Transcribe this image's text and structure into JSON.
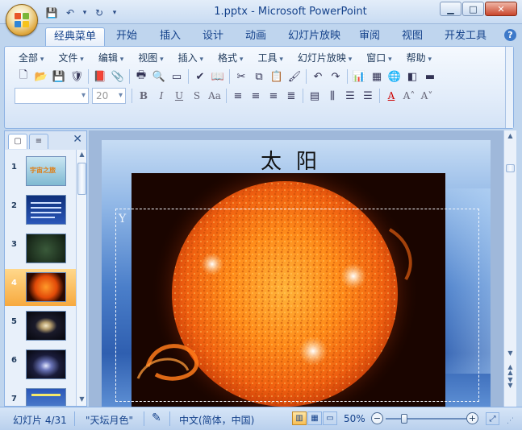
{
  "window": {
    "title": "1.pptx - Microsoft PowerPoint",
    "minimize": "▁",
    "maximize": "□",
    "close": "✕"
  },
  "quick_access": {
    "save": "💾",
    "undo": "↶",
    "redo": "↻",
    "customize": "▾"
  },
  "tabs": [
    "经典菜单",
    "开始",
    "插入",
    "设计",
    "动画",
    "幻灯片放映",
    "审阅",
    "视图",
    "开发工具"
  ],
  "active_tab": "经典菜单",
  "help_label": "?",
  "menu": [
    "全部",
    "文件",
    "编辑",
    "视图",
    "插入",
    "格式",
    "工具",
    "幻灯片放映",
    "窗口",
    "帮助"
  ],
  "toolbar1": [
    {
      "name": "new-document-icon",
      "glyph": "🗋"
    },
    {
      "name": "open-folder-icon",
      "glyph": "📂"
    },
    {
      "name": "save-icon",
      "glyph": "💾"
    },
    {
      "name": "permission-icon",
      "glyph": "🛡"
    },
    {
      "name": "pdf-export-icon",
      "glyph": "📕"
    },
    {
      "name": "attach-icon",
      "glyph": "📎"
    },
    {
      "name": "print-icon",
      "glyph": "🖶"
    },
    {
      "name": "print-preview-icon",
      "glyph": "🔍"
    },
    {
      "name": "slide-show-icon",
      "glyph": "▭"
    },
    {
      "name": "spelling-icon",
      "glyph": "✔"
    },
    {
      "name": "research-icon",
      "glyph": "📖"
    },
    {
      "name": "cut-icon",
      "glyph": "✂"
    },
    {
      "name": "copy-icon",
      "glyph": "⧉"
    },
    {
      "name": "paste-icon",
      "glyph": "📋"
    },
    {
      "name": "format-painter-icon",
      "glyph": "🖌"
    },
    {
      "name": "undo-icon",
      "glyph": "↶"
    },
    {
      "name": "redo-icon",
      "glyph": "↷"
    },
    {
      "name": "chart-icon",
      "glyph": "📊"
    },
    {
      "name": "table-icon",
      "glyph": "▦"
    },
    {
      "name": "hyperlink-icon",
      "glyph": "🌐"
    },
    {
      "name": "color-grayscale-icon",
      "glyph": "◧"
    },
    {
      "name": "fill-color-icon",
      "glyph": "▬"
    }
  ],
  "font_name": "",
  "font_size": "20",
  "format_buttons": [
    "B",
    "I",
    "U",
    "S",
    "Aa"
  ],
  "align_buttons": [
    "≡",
    "≡",
    "≡",
    "≣"
  ],
  "para_buttons": [
    "▤",
    "⫼",
    "☰",
    "☰"
  ],
  "font_color_glyphs": [
    "A",
    "A˄",
    "A˅"
  ],
  "outline": {
    "tab_slides": "▢",
    "tab_outline": "≡",
    "close": "✕"
  },
  "slides": [
    {
      "num": "1",
      "label": "宇宙之旅"
    },
    {
      "num": "2",
      "label": ""
    },
    {
      "num": "3",
      "label": ""
    },
    {
      "num": "4",
      "label": ""
    },
    {
      "num": "5",
      "label": ""
    },
    {
      "num": "6",
      "label": ""
    },
    {
      "num": "7",
      "label": ""
    }
  ],
  "selected_slide": "4",
  "slide": {
    "title": "太阳",
    "placeholder_mark": "Y"
  },
  "status": {
    "slide_info": "幻灯片 4/31",
    "theme": "\"天坛月色\"",
    "language": "中文(简体，中国)",
    "zoom": "50%",
    "zoom_level_percent": 50
  },
  "colors": {
    "accent": "#15428b",
    "ribbon_bg": "#dce8f7",
    "selected_thumb": "#f7a93e",
    "sun_core": "#ff8c1a"
  }
}
